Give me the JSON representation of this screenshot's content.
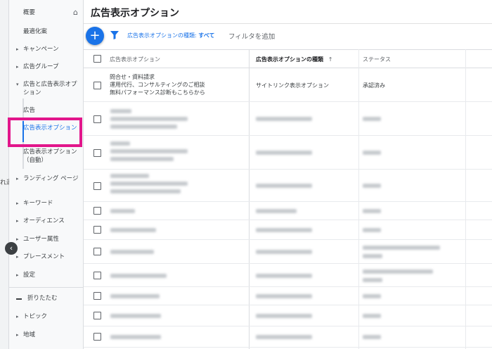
{
  "colors": {
    "accent": "#1a73e8",
    "highlight": "#e2168b",
    "sidebar_bg": "#f8f9fa"
  },
  "left_strip": {
    "peek_text": "れ運",
    "collapse_icon": "chevron-left-icon"
  },
  "sidebar": {
    "overview": "概要",
    "recommendations": "最適化案",
    "campaigns": "キャンペーン",
    "ad_groups": "広告グループ",
    "ads_and_extensions": "広告と広告表示オプション",
    "ads": "広告",
    "extensions": "広告表示オプション",
    "auto_extensions": "広告表示オプション（自動）",
    "landing_pages": "ランディング ページ",
    "keywords": "キーワード",
    "audiences": "オーディエンス",
    "demographics": "ユーザー属性",
    "placements": "プレースメント",
    "settings": "設定",
    "collapse": "折りたたむ",
    "topics": "トピック",
    "locations": "地域"
  },
  "main": {
    "title": "広告表示オプション",
    "filter_chip_prefix": "広告表示オプションの種類:",
    "filter_chip_value": "すべて",
    "add_filter": "フィルタを追加"
  },
  "table": {
    "headers": {
      "extension": "広告表示オプション",
      "type": "広告表示オプションの種類",
      "status": "ステータス"
    },
    "first_row": {
      "lines": [
        "問合せ・資料請求",
        "運用代行、コンサルティングのご相談",
        "無料パフォーマンス診断もこちらから"
      ],
      "type": "サイトリンク表示オプション",
      "status": "承認済み"
    }
  }
}
